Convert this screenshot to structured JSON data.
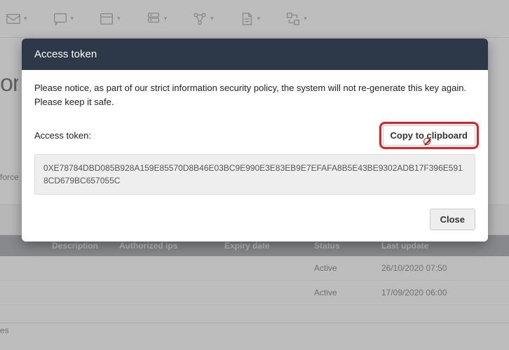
{
  "toolbar": {
    "items": [
      {
        "icon": "mail-icon"
      },
      {
        "icon": "chat-icon"
      },
      {
        "icon": "window-icon"
      },
      {
        "icon": "server-icon"
      },
      {
        "icon": "flow-icon"
      },
      {
        "icon": "document-icon"
      },
      {
        "icon": "transfer-icon"
      }
    ]
  },
  "page": {
    "title_fragment": "or",
    "left_fragment": "force",
    "bottom_fragment": "es"
  },
  "modal": {
    "title": "Access token",
    "notice": "Please notice, as part of our strict information security policy, the system will not re-generate this key again. Please keep it safe.",
    "label": "Access token:",
    "copy_label": "Copy to clipboard",
    "token_value": "0XE78784DBD085B928A159E85570D8B46E03BC9E990E3E83EB9E7EFAFA8B5E43BE9302ADB17F396E5918CD679BC657055C",
    "close_label": "Close"
  },
  "table": {
    "headers": {
      "description": "Description",
      "auth_ips": "Authorized ips",
      "expiry": "Expiry date",
      "status": "Status",
      "last_update": "Last update"
    },
    "rows": [
      {
        "description": "",
        "auth_ips": "",
        "expiry": "",
        "status": "Active",
        "last_update": "26/10/2020 07:50"
      },
      {
        "description": "",
        "auth_ips": "",
        "expiry": "",
        "status": "Active",
        "last_update": "17/09/2020 06:00"
      }
    ]
  }
}
